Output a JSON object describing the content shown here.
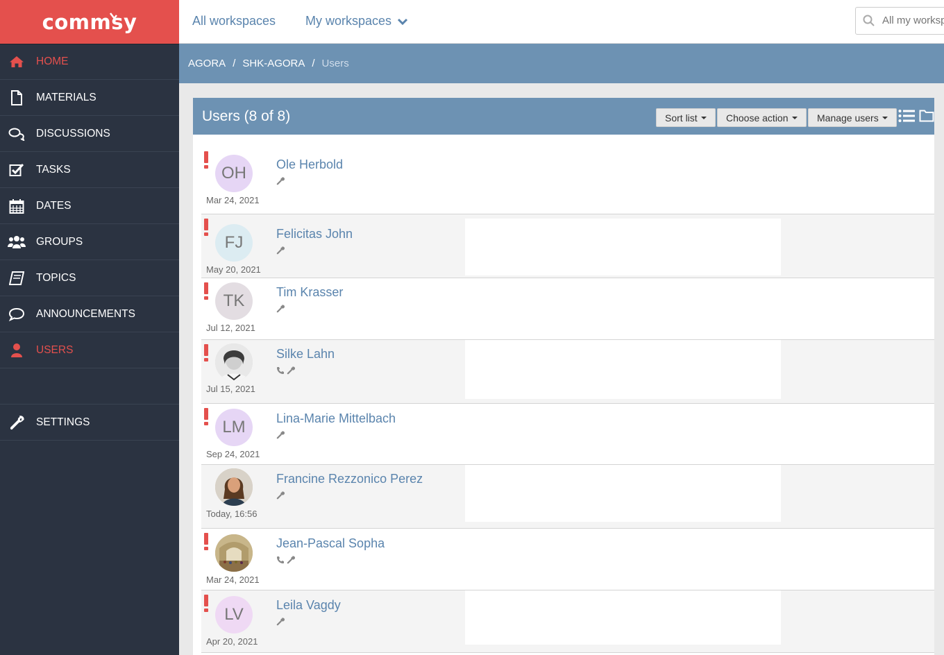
{
  "app": {
    "logo_text": "commsy"
  },
  "sidebar": {
    "items": [
      {
        "label": "HOME",
        "icon": "home-icon"
      },
      {
        "label": "MATERIALS",
        "icon": "file-icon"
      },
      {
        "label": "DISCUSSIONS",
        "icon": "chat-bubbles-icon"
      },
      {
        "label": "TASKS",
        "icon": "checkbox-icon"
      },
      {
        "label": "DATES",
        "icon": "calendar-icon"
      },
      {
        "label": "GROUPS",
        "icon": "group-icon"
      },
      {
        "label": "TOPICS",
        "icon": "book-icon"
      },
      {
        "label": "ANNOUNCEMENTS",
        "icon": "speech-bubble-icon"
      },
      {
        "label": "USERS",
        "icon": "user-icon"
      }
    ],
    "settings": {
      "label": "SETTINGS",
      "icon": "wrench-icon"
    },
    "accent_color": "#e4504d",
    "active_item": "USERS"
  },
  "topbar": {
    "all_workspaces": "All workspaces",
    "my_workspaces": "My workspaces",
    "search_placeholder": "All my workspaces"
  },
  "breadcrumb": [
    "AGORA",
    "SHK-AGORA",
    "Users"
  ],
  "panel": {
    "title": "Users (8 of 8)",
    "buttons": {
      "sort": "Sort list",
      "action": "Choose action",
      "manage": "Manage users"
    }
  },
  "users": [
    {
      "initials": "OH",
      "name": "Ole Herbold",
      "date": "Mar 24, 2021",
      "alert": true,
      "phone": false,
      "avatar_color": "#e6d6f5"
    },
    {
      "initials": "FJ",
      "name": "Felicitas John",
      "date": "May 20, 2021",
      "alert": true,
      "phone": false,
      "avatar_color": "#dcecf2"
    },
    {
      "initials": "TK",
      "name": "Tim Krasser",
      "date": "Jul 12, 2021",
      "alert": true,
      "phone": false,
      "avatar_color": "#e3dde2"
    },
    {
      "initials": "",
      "name": "Silke Lahn",
      "date": "Jul 15, 2021",
      "alert": true,
      "phone": true,
      "avatar_color": "#d9d9d9"
    },
    {
      "initials": "LM",
      "name": "Lina-Marie Mittelbach",
      "date": "Sep 24, 2021",
      "alert": true,
      "phone": false,
      "avatar_color": "#e6d6f5"
    },
    {
      "initials": "",
      "name": "Francine Rezzonico Perez",
      "date": "Today, 16:56",
      "alert": false,
      "phone": false,
      "avatar_color": "#c9b9a6"
    },
    {
      "initials": "",
      "name": "Jean-Pascal Sopha",
      "date": "Mar 24, 2021",
      "alert": true,
      "phone": true,
      "avatar_color": "#b9a886"
    },
    {
      "initials": "LV",
      "name": "Leila Vagdy",
      "date": "Apr 20, 2021",
      "alert": true,
      "phone": false,
      "avatar_color": "#efd9f4"
    }
  ]
}
